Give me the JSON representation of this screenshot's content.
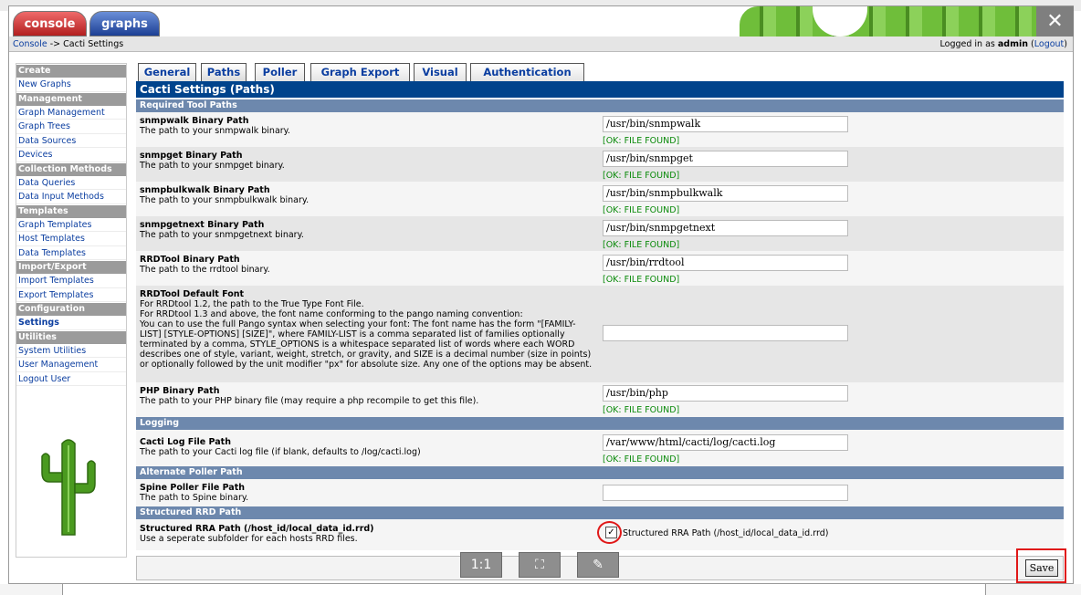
{
  "tabs_top": {
    "console": "console",
    "graphs": "graphs"
  },
  "close_icon_glyph": "✕",
  "nav": {
    "crumb_console": "Console",
    "crumb_sep": " -> ",
    "crumb_current": "Cacti Settings",
    "logged_in_prefix": "Logged in as ",
    "user": "admin",
    "logout": "Logout"
  },
  "sidebar": {
    "create": "Create",
    "new_graphs": "New Graphs",
    "management": "Management",
    "graph_management": "Graph Management",
    "graph_trees": "Graph Trees",
    "data_sources": "Data Sources",
    "devices": "Devices",
    "collection_methods": "Collection Methods",
    "data_queries": "Data Queries",
    "data_input_methods": "Data Input Methods",
    "templates": "Templates",
    "graph_templates": "Graph Templates",
    "host_templates": "Host Templates",
    "data_templates": "Data Templates",
    "import_export": "Import/Export",
    "import_templates": "Import Templates",
    "export_templates": "Export Templates",
    "configuration": "Configuration",
    "settings": "Settings",
    "utilities": "Utilities",
    "system_utilities": "System Utilities",
    "user_management": "User Management",
    "logout_user": "Logout User"
  },
  "settings_tabs": {
    "general": "General",
    "paths": "Paths",
    "poller": "Poller",
    "graph_export": "Graph Export",
    "visual": "Visual",
    "authentication": "Authentication"
  },
  "title": "Cacti Settings (Paths)",
  "sections": {
    "required": "Required Tool Paths",
    "logging": "Logging",
    "alt_poller": "Alternate Poller Path",
    "rrd_path": "Structured RRD Path"
  },
  "ok_text": "[OK: FILE FOUND]",
  "fields": {
    "snmpwalk": {
      "title": "snmpwalk Binary Path",
      "desc": "The path to your snmpwalk binary.",
      "value": "/usr/bin/snmpwalk"
    },
    "snmpget": {
      "title": "snmpget Binary Path",
      "desc": "The path to your snmpget binary.",
      "value": "/usr/bin/snmpget"
    },
    "snmpbulkwalk": {
      "title": "snmpbulkwalk Binary Path",
      "desc": "The path to your snmpbulkwalk binary.",
      "value": "/usr/bin/snmpbulkwalk"
    },
    "snmpgetnext": {
      "title": "snmpgetnext Binary Path",
      "desc": "The path to your snmpgetnext binary.",
      "value": "/usr/bin/snmpgetnext"
    },
    "rrdtool": {
      "title": "RRDTool Binary Path",
      "desc": "The path to the rrdtool binary.",
      "value": "/usr/bin/rrdtool"
    },
    "font": {
      "title": "RRDTool Default Font",
      "desc1": "For RRDtool 1.2, the path to the True Type Font File.",
      "desc2": "For RRDtool 1.3 and above, the font name conforming to the pango naming convention:",
      "desc3": "You can to use the full Pango syntax when selecting your font: The font name has the form \"[FAMILY-LIST] [STYLE-OPTIONS] [SIZE]\", where FAMILY-LIST is a comma separated list of families optionally terminated by a comma, STYLE_OPTIONS is a whitespace separated list of words where each WORD describes one of style, variant, weight, stretch, or gravity, and SIZE is a decimal number (size in points) or optionally followed by the unit modifier \"px\" for absolute size. Any one of the options may be absent.",
      "value": ""
    },
    "php": {
      "title": "PHP Binary Path",
      "desc": "The path to your PHP binary file (may require a php recompile to get this file).",
      "value": "/usr/bin/php"
    },
    "cactilog": {
      "title": "Cacti Log File Path",
      "desc": "The path to your Cacti log file (if blank, defaults to /log/cacti.log)",
      "value": "/var/www/html/cacti/log/cacti.log"
    },
    "spine": {
      "title": "Spine Poller File Path",
      "desc": "The path to Spine binary.",
      "value": ""
    },
    "rra": {
      "title": "Structured RRA Path (/host_id/local_data_id.rrd)",
      "desc": "Use a seperate subfolder for each hosts RRD files.",
      "checkbox_label": "Structured RRA Path (/host_id/local_data_id.rrd)",
      "checked": "✓"
    }
  },
  "footer_buttons": {
    "actual_size": "1:1",
    "fit": "⛶",
    "edit": "✎"
  },
  "save": "Save"
}
